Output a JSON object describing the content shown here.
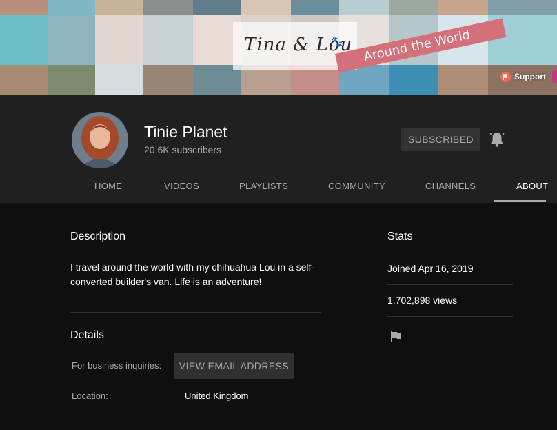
{
  "banner": {
    "brand_text": "Tina & Lou",
    "ribbon_text": "Around the World",
    "support_label": "Support"
  },
  "channel": {
    "name": "Tinie Planet",
    "subscribers": "20.6K subscribers",
    "subscribe_label": "SUBSCRIBED"
  },
  "tabs": [
    "HOME",
    "VIDEOS",
    "PLAYLISTS",
    "COMMUNITY",
    "CHANNELS",
    "ABOUT"
  ],
  "active_tab": "ABOUT",
  "about": {
    "description_title": "Description",
    "description_text": "I travel around the world with my chihuahua Lou in a self-converted builder's van. Life is an adventure!",
    "details_title": "Details",
    "business_label": "For business inquiries:",
    "view_email_label": "VIEW EMAIL ADDRESS",
    "location_label": "Location:",
    "location_value": "United Kingdom"
  },
  "stats": {
    "title": "Stats",
    "joined": "Joined Apr 16, 2019",
    "views": "1,702,898 views"
  },
  "colors": {
    "background": "#0f0f0f",
    "header": "#202020",
    "ribbon": "#d4707a",
    "patreon": "#f96854"
  },
  "icons": {
    "notifications": "bell-icon",
    "report": "flag-icon",
    "support": "patreon-icon"
  }
}
